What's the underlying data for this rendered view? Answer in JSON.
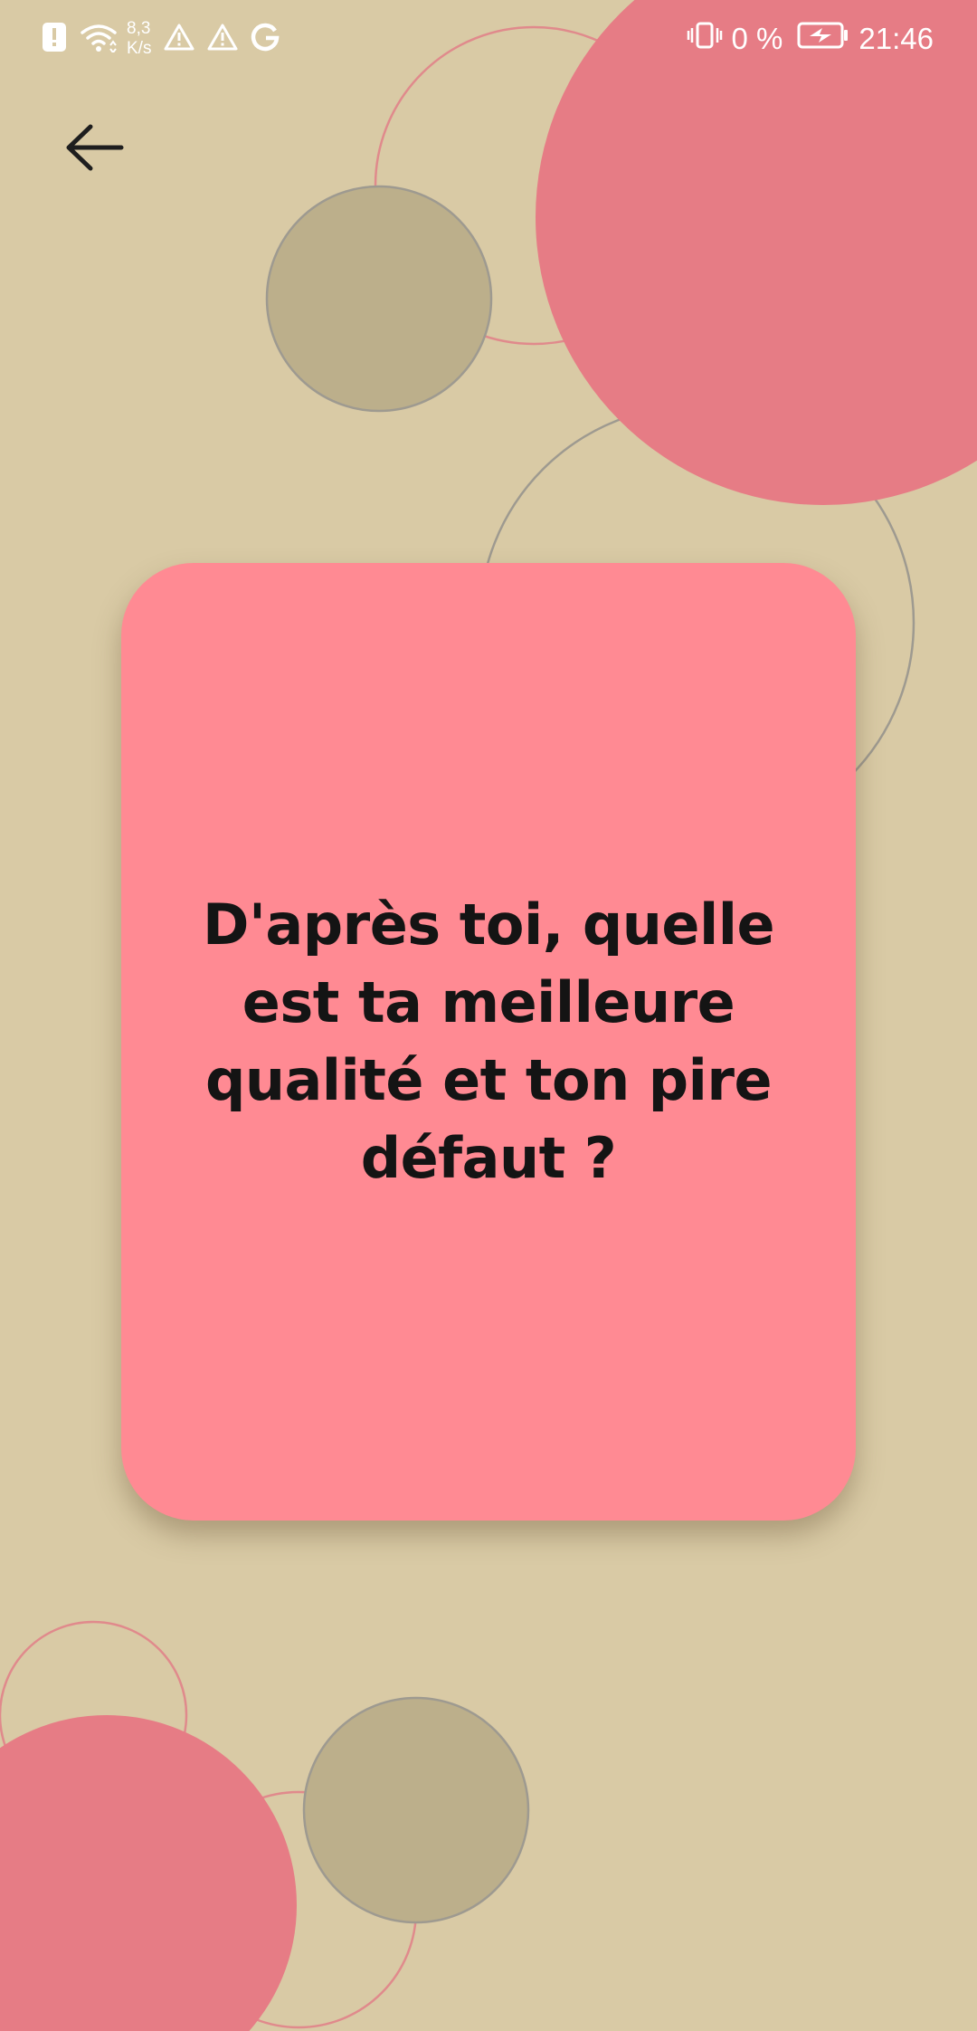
{
  "status_bar": {
    "net_speed_value": "8,3",
    "net_speed_unit": "K/s",
    "battery_percent": "0 %",
    "time": "21:46",
    "icons": [
      "alert-icon",
      "wifi-icon",
      "warning-icon",
      "warning-icon",
      "google-icon",
      "vibrate-icon",
      "battery-charging-icon"
    ]
  },
  "toolbar": {
    "back_icon": "arrow-left-icon"
  },
  "card": {
    "question": "D'après toi, quelle est ta meilleure qualité et ton pire défaut ?"
  },
  "colors": {
    "background": "#d9caa5",
    "card": "#ff8a93",
    "pink_circle": "#e67c85",
    "grey_circle": "#bcaf8b",
    "text": "#141414"
  }
}
